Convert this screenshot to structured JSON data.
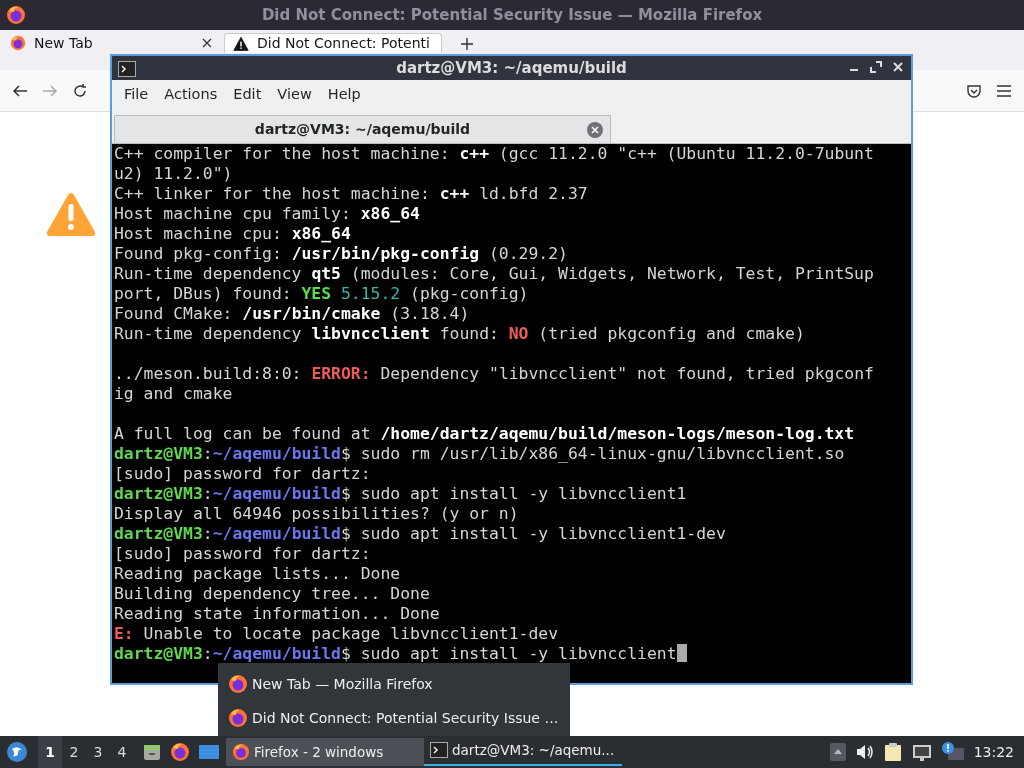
{
  "browser": {
    "title": "Did Not Connect: Potential Security Issue — Mozilla Firefox",
    "tabs": [
      {
        "label": "New Tab",
        "selected": false
      },
      {
        "label": "Did Not Connect: Potenti",
        "selected": true
      }
    ]
  },
  "terminal": {
    "title": "dartz@VM3: ~/aqemu/build",
    "menu": [
      "File",
      "Actions",
      "Edit",
      "View",
      "Help"
    ],
    "tab": "dartz@VM3: ~/aqemu/build",
    "lines": [
      {
        "segments": [
          {
            "text": "C++ compiler for the host machine: ",
            "kind": "plain"
          },
          {
            "text": "c++",
            "kind": "bold"
          },
          {
            "text": " (gcc 11.2.0 \"c++ (Ubuntu 11.2.0-7ubunt",
            "kind": "plain"
          }
        ]
      },
      {
        "segments": [
          {
            "text": "u2) 11.2.0\")",
            "kind": "plain"
          }
        ]
      },
      {
        "segments": [
          {
            "text": "C++ linker for the host machine: ",
            "kind": "plain"
          },
          {
            "text": "c++",
            "kind": "bold"
          },
          {
            "text": " ld.bfd 2.37",
            "kind": "plain"
          }
        ]
      },
      {
        "segments": [
          {
            "text": "Host machine cpu family: ",
            "kind": "plain"
          },
          {
            "text": "x86_64",
            "kind": "bold"
          }
        ]
      },
      {
        "segments": [
          {
            "text": "Host machine cpu: ",
            "kind": "plain"
          },
          {
            "text": "x86_64",
            "kind": "bold"
          }
        ]
      },
      {
        "segments": [
          {
            "text": "Found pkg-config: ",
            "kind": "plain"
          },
          {
            "text": "/usr/bin/pkg-config",
            "kind": "bold"
          },
          {
            "text": " (0.29.2)",
            "kind": "plain"
          }
        ]
      },
      {
        "segments": [
          {
            "text": "Run-time dependency ",
            "kind": "plain"
          },
          {
            "text": "qt5",
            "kind": "bold"
          },
          {
            "text": " (modules: Core, Gui, Widgets, Network, Test, PrintSup",
            "kind": "plain"
          }
        ]
      },
      {
        "segments": [
          {
            "text": "port, DBus) found: ",
            "kind": "plain"
          },
          {
            "text": "YES",
            "kind": "ok"
          },
          {
            "text": " 5.15.2",
            "kind": "version"
          },
          {
            "text": " (pkg-config)",
            "kind": "plain"
          }
        ]
      },
      {
        "segments": [
          {
            "text": "Found CMake: ",
            "kind": "plain"
          },
          {
            "text": "/usr/bin/cmake",
            "kind": "bold"
          },
          {
            "text": " (3.18.4)",
            "kind": "plain"
          }
        ]
      },
      {
        "segments": [
          {
            "text": "Run-time dependency ",
            "kind": "plain"
          },
          {
            "text": "libvncclient",
            "kind": "bold"
          },
          {
            "text": " found: ",
            "kind": "plain"
          },
          {
            "text": "NO",
            "kind": "error"
          },
          {
            "text": " (tried pkgconfig and cmake)",
            "kind": "plain"
          }
        ]
      },
      {
        "gap_before": true,
        "segments": [
          {
            "text": "../meson.build:8:0: ",
            "kind": "plain"
          },
          {
            "text": "ERROR:",
            "kind": "error"
          },
          {
            "text": " Dependency \"libvncclient\" not found, tried pkgconf",
            "kind": "plain"
          }
        ]
      },
      {
        "segments": [
          {
            "text": "ig and cmake",
            "kind": "plain"
          }
        ]
      },
      {
        "gap_before": true,
        "segments": [
          {
            "text": "A full log can be found at ",
            "kind": "plain"
          },
          {
            "text": "/home/dartz/aqemu/build/meson-logs/meson-log.txt",
            "kind": "bold"
          }
        ]
      },
      {
        "segments": [
          {
            "text": "dartz@VM3",
            "kind": "user"
          },
          {
            "text": ":",
            "kind": "plain"
          },
          {
            "text": "~/aqemu/build",
            "kind": "path"
          },
          {
            "text": "$ sudo rm /usr/lib/x86_64-linux-gnu/libvncclient.so",
            "kind": "plain"
          }
        ]
      },
      {
        "segments": [
          {
            "text": "[sudo] password for dartz:",
            "kind": "plain"
          }
        ]
      },
      {
        "segments": [
          {
            "text": "dartz@VM3",
            "kind": "user"
          },
          {
            "text": ":",
            "kind": "plain"
          },
          {
            "text": "~/aqemu/build",
            "kind": "path"
          },
          {
            "text": "$ sudo apt install -y libvncclient1",
            "kind": "plain"
          }
        ]
      },
      {
        "segments": [
          {
            "text": "Display all 64946 possibilities? (y or n)",
            "kind": "plain"
          }
        ]
      },
      {
        "segments": [
          {
            "text": "dartz@VM3",
            "kind": "user"
          },
          {
            "text": ":",
            "kind": "plain"
          },
          {
            "text": "~/aqemu/build",
            "kind": "path"
          },
          {
            "text": "$ sudo apt install -y libvncclient1-dev",
            "kind": "plain"
          }
        ]
      },
      {
        "segments": [
          {
            "text": "[sudo] password for dartz:",
            "kind": "plain"
          }
        ]
      },
      {
        "segments": [
          {
            "text": "Reading package lists... Done",
            "kind": "plain"
          }
        ]
      },
      {
        "segments": [
          {
            "text": "Building dependency tree... Done",
            "kind": "plain"
          }
        ]
      },
      {
        "segments": [
          {
            "text": "Reading state information... Done",
            "kind": "plain"
          }
        ]
      },
      {
        "segments": [
          {
            "text": "E:",
            "kind": "error"
          },
          {
            "text": " Unable to locate package libvncclient1-dev",
            "kind": "plain"
          }
        ]
      },
      {
        "cursor": true,
        "segments": [
          {
            "text": "dartz@VM3",
            "kind": "user"
          },
          {
            "text": ":",
            "kind": "plain"
          },
          {
            "text": "~/aqemu/build",
            "kind": "path"
          },
          {
            "text": "$ sudo apt install -y libvncclient",
            "kind": "plain"
          }
        ]
      }
    ]
  },
  "popup": {
    "items": [
      "New Tab — Mozilla Firefox",
      "Did Not Connect: Potential Security Issue …"
    ]
  },
  "taskbar": {
    "workspaces": [
      {
        "label": "1",
        "selected": true
      },
      {
        "label": "2",
        "selected": false
      },
      {
        "label": "3",
        "selected": false
      },
      {
        "label": "4",
        "selected": false
      }
    ],
    "tasks": [
      {
        "label": "Firefox - 2 windows",
        "selected": true
      },
      {
        "label": "dartz@VM3: ~/aqemu...",
        "selected": false
      }
    ],
    "clock": "13:22"
  }
}
